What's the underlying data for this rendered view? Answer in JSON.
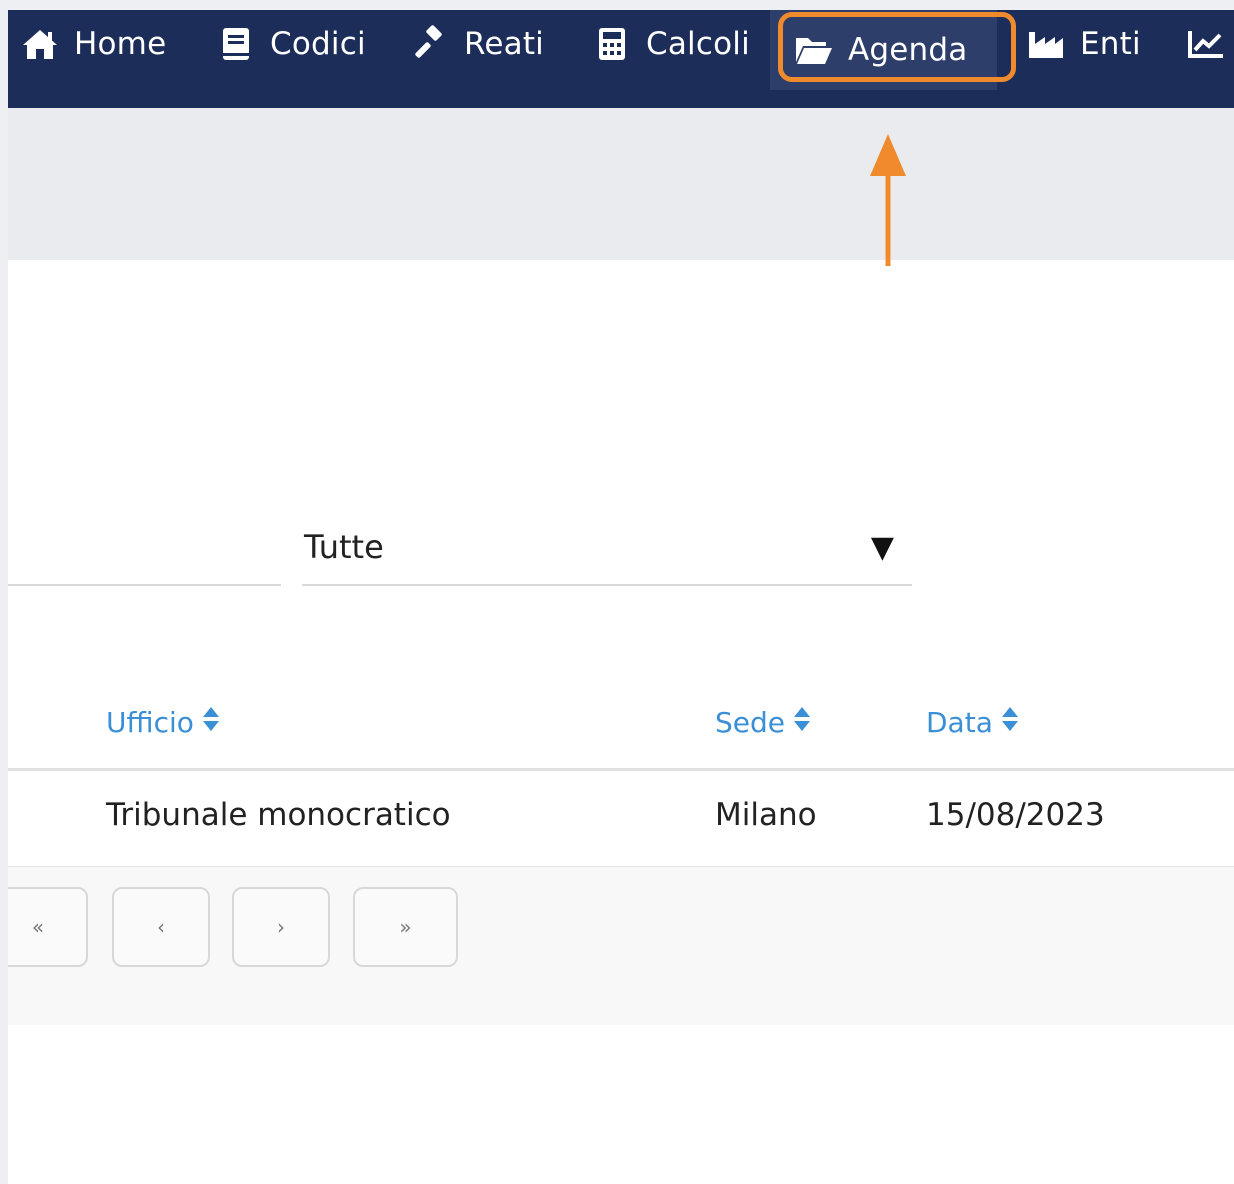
{
  "nav": {
    "items": [
      {
        "label": "Home",
        "icon": "home-icon"
      },
      {
        "label": "Codici",
        "icon": "book-icon"
      },
      {
        "label": "Reati",
        "icon": "gavel-icon"
      },
      {
        "label": "Calcoli",
        "icon": "calculator-icon"
      },
      {
        "label": "Agenda",
        "icon": "folder-open-icon"
      },
      {
        "label": "Enti",
        "icon": "industry-icon"
      },
      {
        "label": "",
        "icon": "chart-line-icon"
      }
    ],
    "active": "Agenda",
    "highlight_color": "#ef8b2c",
    "background": "#1d2d5a"
  },
  "filter": {
    "select_value": "Tutte",
    "caret": "▼"
  },
  "table": {
    "columns": [
      "Ufficio",
      "Sede",
      "Data"
    ],
    "header_color": "#3b8fd6",
    "rows": [
      {
        "ufficio": "Tribunale monocratico",
        "sede": "Milano",
        "data": "15/08/2023"
      }
    ]
  },
  "pagination": {
    "first": "«",
    "prev": "‹",
    "next": "›",
    "last": "»"
  }
}
